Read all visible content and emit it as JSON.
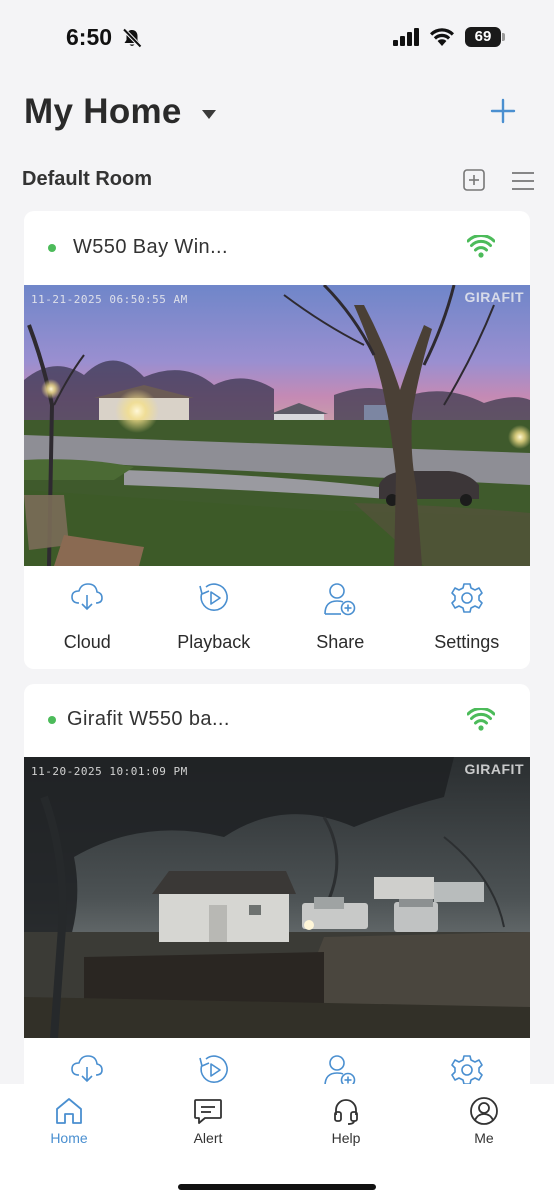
{
  "status_bar": {
    "time": "6:50",
    "battery": "69",
    "icons": [
      "bell-slash-icon",
      "cellular-signal-icon",
      "wifi-icon",
      "battery-icon"
    ]
  },
  "header": {
    "title": "My Home",
    "dropdown_icon": "caret-down-icon",
    "add_icon": "plus-icon"
  },
  "room": {
    "title": "Default Room",
    "icons": [
      "grid-view-icon",
      "list-view-icon"
    ]
  },
  "cameras": [
    {
      "name": "W550 Bay Win...",
      "status": "online",
      "timestamp": "11-21-2025 06:50:55 AM",
      "watermark": "GIRAFIT"
    },
    {
      "name": "Girafit W550 ba...",
      "status": "online",
      "timestamp": "11-20-2025 10:01:09 PM",
      "watermark": "GIRAFIT"
    }
  ],
  "actions": [
    {
      "label": "Cloud",
      "icon": "cloud-icon"
    },
    {
      "label": "Playback",
      "icon": "playback-icon"
    },
    {
      "label": "Share",
      "icon": "share-user-icon"
    },
    {
      "label": "Settings",
      "icon": "gear-icon"
    }
  ],
  "nav": [
    {
      "label": "Home",
      "icon": "home-icon",
      "active": true
    },
    {
      "label": "Alert",
      "icon": "alert-message-icon",
      "active": false
    },
    {
      "label": "Help",
      "icon": "headset-icon",
      "active": false
    },
    {
      "label": "Me",
      "icon": "user-icon",
      "active": false
    }
  ],
  "colors": {
    "accent": "#4a8fd0",
    "online": "#4cbb5a",
    "background": "#f4f4f6"
  }
}
